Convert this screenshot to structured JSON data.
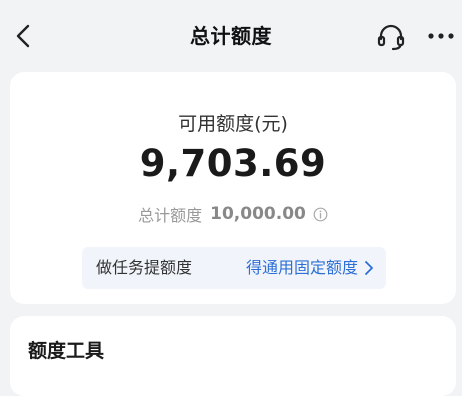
{
  "header": {
    "title": "总计额度",
    "back_icon": "chevron-left-icon",
    "service_icon": "headset-icon",
    "more_icon": "more-dots-icon"
  },
  "quota": {
    "available_label": "可用额度(元)",
    "available_amount": "9,703.69",
    "total_label": "总计额度",
    "total_amount": "10,000.00",
    "info_icon": "info-icon"
  },
  "task": {
    "label": "做任务提额度",
    "link": "得通用固定额度",
    "link_color": "#2d6fd6"
  },
  "tools": {
    "title": "额度工具"
  }
}
